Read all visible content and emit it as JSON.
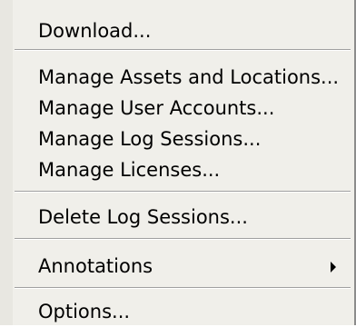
{
  "menu": {
    "items": [
      {
        "label": "Download..."
      },
      {
        "label": "Manage Assets and Locations..."
      },
      {
        "label": "Manage User Accounts..."
      },
      {
        "label": "Manage Log Sessions..."
      },
      {
        "label": "Manage Licenses..."
      },
      {
        "label": "Delete Log Sessions..."
      },
      {
        "label": "Annotations",
        "submenu_icon": "submenu-arrow-icon"
      },
      {
        "label": "Options..."
      }
    ]
  },
  "colors": {
    "menu_background": "#f0efea",
    "separator_dark": "#a0a0a0",
    "text": "#000000"
  }
}
